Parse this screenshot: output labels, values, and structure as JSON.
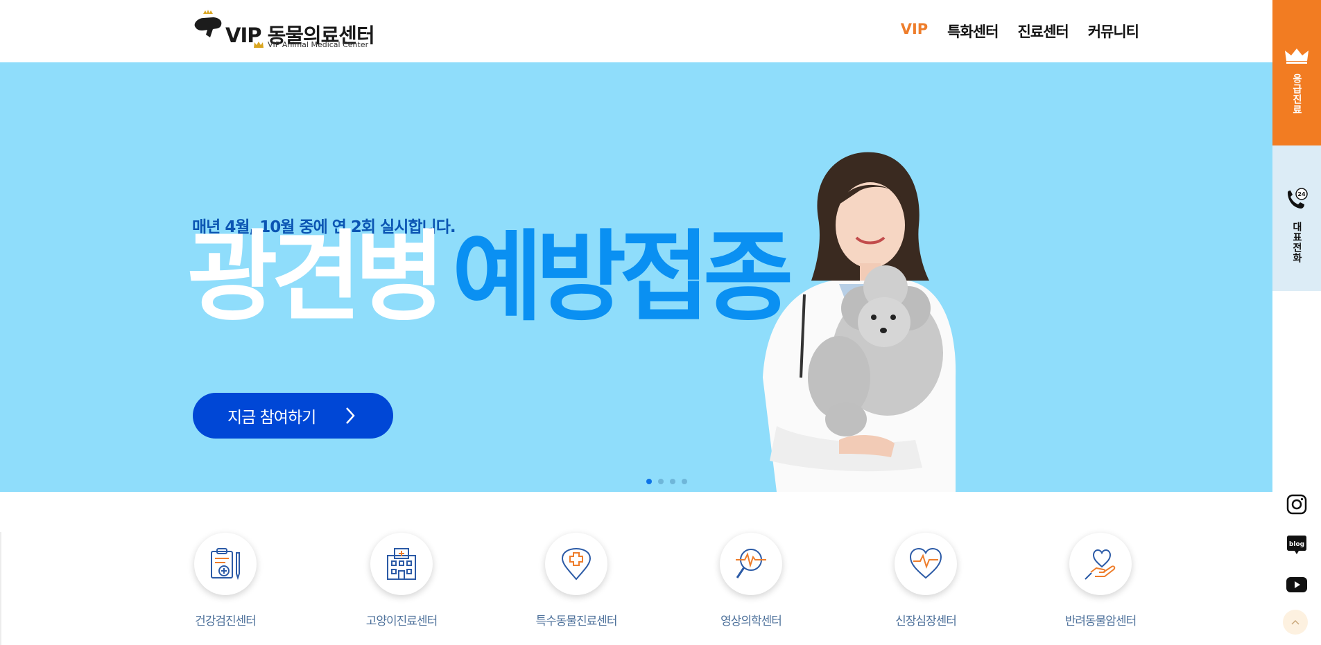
{
  "header": {
    "logo_title": "VIP 동물의료센터",
    "logo_subtitle": "VIP Animal Medical Center",
    "nav": [
      "VIP",
      "특화센터",
      "진료센터",
      "커뮤니티"
    ]
  },
  "hero": {
    "subtitle": "매년 4월, 10월 중에 연 2회 실시합니다.",
    "title_white": "광견병",
    "title_blue": "예방접종",
    "cta_label": "지금 참여하기",
    "slide_count": 4,
    "active_slide": 1
  },
  "sidebar": {
    "emergency_label": "응급진료",
    "phone_badge": "24",
    "phone_label": "대표전화",
    "social": [
      "instagram-icon",
      "blog-icon",
      "youtube-icon"
    ],
    "blog_text": "blog"
  },
  "centers": [
    {
      "label": "건강검진센터",
      "icon": "clipboard-health-icon"
    },
    {
      "label": "고양이진료센터",
      "icon": "hospital-building-icon"
    },
    {
      "label": "특수동물진료센터",
      "icon": "medical-pin-icon"
    },
    {
      "label": "영상의학센터",
      "icon": "magnifier-pulse-icon"
    },
    {
      "label": "신장심장센터",
      "icon": "heart-pulse-icon"
    },
    {
      "label": "반려동물암센터",
      "icon": "heart-hand-icon"
    }
  ],
  "colors": {
    "brand_orange": "#ee7d2b",
    "hero_bg": "#8fddfb",
    "hero_title_blue": "#0a90f2",
    "cta_blue": "#0047d6",
    "subtitle_blue": "#0b55b3",
    "center_label": "#50739c"
  }
}
